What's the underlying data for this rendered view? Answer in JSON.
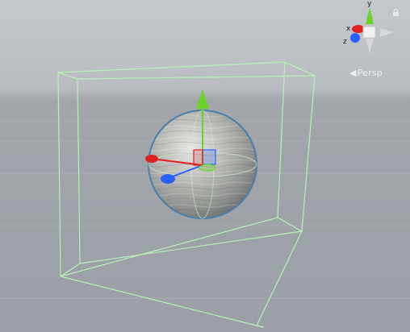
{
  "viewport": {
    "projection_label": "Persp",
    "gizmo_labels": {
      "x": "x",
      "y": "y",
      "z": "z"
    }
  },
  "colors": {
    "bounds_box": "#b8f0b8",
    "x_axis": "#e0201f",
    "y_axis": "#6bd22a",
    "z_axis": "#2a60ff",
    "selection_outline": "#4a7fa8"
  },
  "icons": [
    "lock-icon",
    "perspective-arrow-icon",
    "scene-orientation-gizmo",
    "move-tool-gizmo"
  ]
}
